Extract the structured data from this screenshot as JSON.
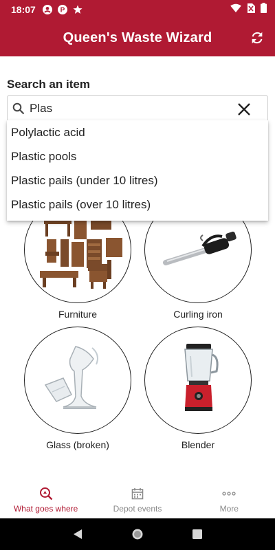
{
  "status_bar": {
    "time": "18:07",
    "icons": [
      "account-circle-icon",
      "parking-p-icon",
      "star-icon",
      "wifi-icon",
      "no-sim-icon",
      "battery-icon"
    ]
  },
  "app_bar": {
    "title": "Queen's Waste Wizard",
    "refresh_icon": "refresh-icon",
    "background": "#b01a33"
  },
  "search": {
    "label": "Search an item",
    "value": "Plas",
    "search_icon": "search-icon",
    "clear_icon": "close-icon"
  },
  "suggestions": [
    "Polylactic acid",
    "Plastic pools",
    "Plastic pails (under 10 litres)",
    "Plastic pails (over 10 litres)"
  ],
  "items": [
    {
      "label": "Furniture"
    },
    {
      "label": "Curling iron"
    },
    {
      "label": "Glass (broken)"
    },
    {
      "label": "Blender"
    }
  ],
  "bottom_nav": [
    {
      "label": "What goes where",
      "icon": "recycle-search-icon",
      "active": true
    },
    {
      "label": "Depot events",
      "icon": "calendar-icon",
      "active": false
    },
    {
      "label": "More",
      "icon": "more-dots-icon",
      "active": false
    }
  ],
  "colors": {
    "accent": "#b01a33",
    "inactive": "#8a8a8a"
  }
}
